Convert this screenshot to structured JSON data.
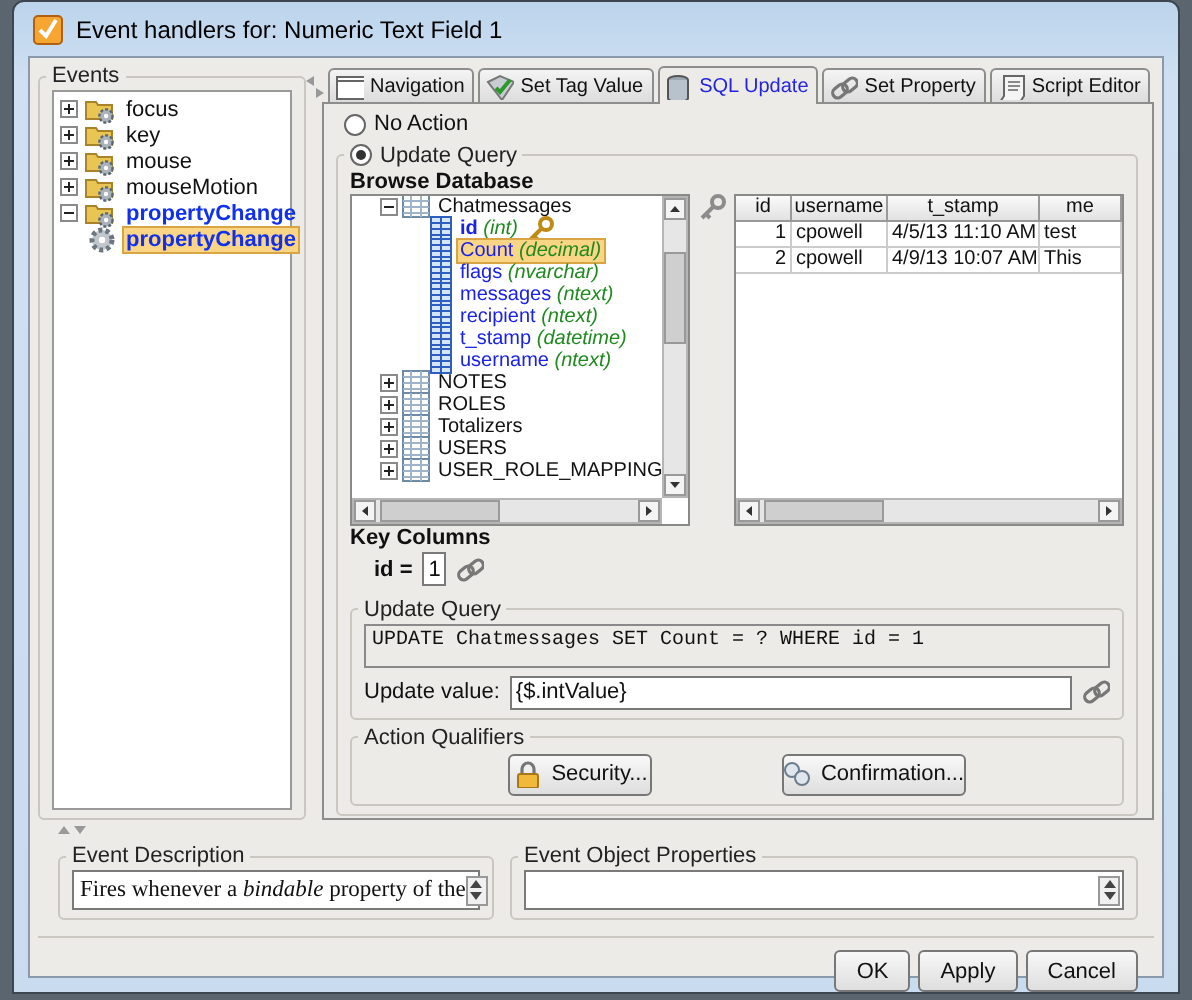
{
  "window": {
    "title": "Event handlers for: Numeric Text Field 1"
  },
  "events": {
    "label": "Events",
    "items": [
      {
        "label": "focus",
        "kind": "group",
        "expanded": false,
        "configured": false,
        "selected": false
      },
      {
        "label": "key",
        "kind": "group",
        "expanded": false,
        "configured": false,
        "selected": false
      },
      {
        "label": "mouse",
        "kind": "group",
        "expanded": false,
        "configured": false,
        "selected": false
      },
      {
        "label": "mouseMotion",
        "kind": "group",
        "expanded": false,
        "configured": false,
        "selected": false
      },
      {
        "label": "propertyChange",
        "kind": "group",
        "expanded": true,
        "configured": true,
        "selected": false,
        "children": [
          {
            "label": "propertyChange",
            "kind": "event",
            "configured": true,
            "selected": true
          }
        ]
      }
    ]
  },
  "tabs": [
    {
      "label": "Navigation",
      "kind": "navigation",
      "selected": false
    },
    {
      "label": "Set Tag Value",
      "kind": "tag",
      "selected": false
    },
    {
      "label": "SQL Update",
      "kind": "sql",
      "selected": true
    },
    {
      "label": "Set Property",
      "kind": "property",
      "selected": false
    },
    {
      "label": "Script Editor",
      "kind": "script",
      "selected": false
    }
  ],
  "actions": [
    {
      "label": "No Action",
      "selected": false
    },
    {
      "label": "Update Query",
      "selected": true
    }
  ],
  "browse_database": {
    "label": "Browse Database",
    "tables": [
      {
        "name": "Chatmessages",
        "expanded": true,
        "columns": [
          {
            "name": "id",
            "type": "(int)",
            "key": true,
            "selected": false
          },
          {
            "name": "Count",
            "type": "(decimal)",
            "key": false,
            "selected": true
          },
          {
            "name": "flags",
            "type": "(nvarchar)",
            "key": false,
            "selected": false
          },
          {
            "name": "messages",
            "type": "(ntext)",
            "key": false,
            "selected": false
          },
          {
            "name": "recipient",
            "type": "(ntext)",
            "key": false,
            "selected": false
          },
          {
            "name": "t_stamp",
            "type": "(datetime)",
            "key": false,
            "selected": false
          },
          {
            "name": "username",
            "type": "(ntext)",
            "key": false,
            "selected": false
          }
        ]
      },
      {
        "name": "NOTES",
        "expanded": false
      },
      {
        "name": "ROLES",
        "expanded": false
      },
      {
        "name": "Totalizers",
        "expanded": false
      },
      {
        "name": "USERS",
        "expanded": false
      },
      {
        "name": "USER_ROLE_MAPPING",
        "expanded": false
      }
    ]
  },
  "preview_table": {
    "columns": [
      "id",
      "username",
      "t_stamp",
      "me"
    ],
    "rows": [
      [
        "1",
        "cpowell",
        "4/5/13 11:10 AM",
        "test"
      ],
      [
        "2",
        "cpowell",
        "4/9/13 10:07 AM",
        "This"
      ]
    ]
  },
  "key_columns": {
    "label": "Key Columns",
    "entries": [
      {
        "name": "id =",
        "value": "1"
      }
    ]
  },
  "update_query": {
    "label": "Update Query",
    "query": "UPDATE Chatmessages SET Count = ? WHERE id = 1",
    "value_label": "Update value:",
    "value": "{$.intValue}"
  },
  "action_qualifiers": {
    "label": "Action Qualifiers",
    "buttons": [
      {
        "label": "Security...",
        "kind": "security"
      },
      {
        "label": "Confirmation...",
        "kind": "confirmation"
      }
    ]
  },
  "event_description": {
    "label": "Event Description",
    "text": "Fires whenever a *bindable* property of the"
  },
  "event_object_properties": {
    "label": "Event Object Properties"
  },
  "buttons": [
    "OK",
    "Apply",
    "Cancel"
  ]
}
